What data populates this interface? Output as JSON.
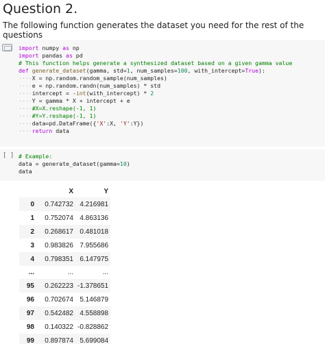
{
  "question": {
    "title": "Question 2.",
    "description": "The following function generates the dataset you need for the rest of the questions"
  },
  "cell1": {
    "lines": [
      [
        {
          "t": "import",
          "c": "kw"
        },
        {
          "t": " numpy "
        },
        {
          "t": "as",
          "c": "kw"
        },
        {
          "t": " np"
        }
      ],
      [
        {
          "t": "import",
          "c": "kw"
        },
        {
          "t": " pandas "
        },
        {
          "t": "as",
          "c": "kw"
        },
        {
          "t": " pd"
        }
      ],
      [
        {
          "t": "# This function helps generate a synthesized dataset based on a given gamma value",
          "c": "cm"
        }
      ],
      [
        {
          "t": "def",
          "c": "kw"
        },
        {
          "t": " "
        },
        {
          "t": "generate_dataset",
          "c": "fn"
        },
        {
          "t": "(gamma, std="
        },
        {
          "t": "1",
          "c": "num"
        },
        {
          "t": ", num_samples="
        },
        {
          "t": "100",
          "c": "num"
        },
        {
          "t": ", with_intercept="
        },
        {
          "t": "True",
          "c": "kw"
        },
        {
          "t": "):"
        }
      ],
      [
        {
          "t": "····",
          "c": "dots"
        },
        {
          "t": "X = np.random.random_sample(num_samples)"
        }
      ],
      [
        {
          "t": "····",
          "c": "dots"
        },
        {
          "t": "e = np.random.randn(num_samples) * std"
        }
      ],
      [
        {
          "t": "····",
          "c": "dots"
        },
        {
          "t": "intercept = -"
        },
        {
          "t": "int",
          "c": "fn"
        },
        {
          "t": "(with_intercept) * "
        },
        {
          "t": "2",
          "c": "num"
        }
      ],
      [
        {
          "t": "····",
          "c": "dots"
        },
        {
          "t": "Y = gamma * X + intercept + e"
        }
      ],
      [
        {
          "t": "····",
          "c": "dots"
        },
        {
          "t": "#X=X.reshape(-1, 1)",
          "c": "cm"
        }
      ],
      [
        {
          "t": "····",
          "c": "dots"
        },
        {
          "t": "#Y=Y.reshape(-1, 1)",
          "c": "cm"
        }
      ],
      [
        {
          "t": "····",
          "c": "dots"
        },
        {
          "t": "data=pd.DataFrame({"
        },
        {
          "t": "'X'",
          "c": "str"
        },
        {
          "t": ":X, "
        },
        {
          "t": "'Y'",
          "c": "str"
        },
        {
          "t": ":Y})"
        }
      ],
      [
        {
          "t": "····",
          "c": "dots"
        },
        {
          "t": "return",
          "c": "kw"
        },
        {
          "t": " data"
        }
      ]
    ]
  },
  "cell2": {
    "exec_count": "[ ]",
    "lines": [
      [
        {
          "t": "# Example:",
          "c": "cm"
        }
      ],
      [
        {
          "t": "data = generate_dataset(gamma="
        },
        {
          "t": "10",
          "c": "num"
        },
        {
          "t": ")"
        }
      ],
      [
        {
          "t": "data"
        }
      ]
    ]
  },
  "table": {
    "columns": [
      "",
      "X",
      "Y"
    ],
    "rows": [
      {
        "index": "0",
        "x": "0.742732",
        "y": "4.216981"
      },
      {
        "index": "1",
        "x": "0.752074",
        "y": "4.863136"
      },
      {
        "index": "2",
        "x": "0.268617",
        "y": "0.481018"
      },
      {
        "index": "3",
        "x": "0.983826",
        "y": "7.955686"
      },
      {
        "index": "4",
        "x": "0.798351",
        "y": "6.147975"
      },
      {
        "index": "...",
        "x": "...",
        "y": "..."
      },
      {
        "index": "95",
        "x": "0.262223",
        "y": "-1.378651"
      },
      {
        "index": "96",
        "x": "0.702674",
        "y": "5.146879"
      },
      {
        "index": "97",
        "x": "0.542482",
        "y": "4.558898"
      },
      {
        "index": "98",
        "x": "0.140322",
        "y": "-0.828862"
      },
      {
        "index": "99",
        "x": "0.897874",
        "y": "5.699084"
      }
    ]
  }
}
